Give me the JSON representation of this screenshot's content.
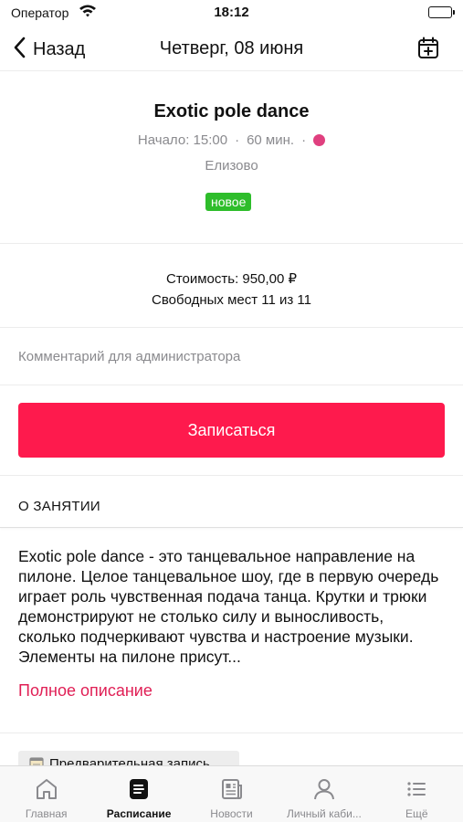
{
  "status_bar": {
    "carrier": "Оператор",
    "time": "18:12"
  },
  "nav": {
    "back_label": "Назад",
    "title": "Четверг, 08 июня",
    "back_icon": "chevron-left-icon",
    "calendar_icon": "calendar-add-icon"
  },
  "class_info": {
    "title": "Exotic pole dance",
    "start": "Начало: 15:00",
    "separator": "·",
    "duration": "60 мин.",
    "color": "#e0407f",
    "location": "Елизово",
    "badge": "новое",
    "badge_color": "#2ebd2b"
  },
  "pricing": {
    "cost": "Стоимость: 950,00 ₽",
    "seats": "Свободных мест 11 из 11"
  },
  "comment": {
    "placeholder": "Комментарий для администратора",
    "value": ""
  },
  "signup": {
    "label": "Записаться",
    "color": "#fe1a4d"
  },
  "about": {
    "title": "О ЗАНЯТИИ",
    "text": "Exotic pole dance - это танцевальное направление на пилоне. Целое танцевальное шоу, где в первую очередь играет роль чувственная подача танца. Крутки и трюки демонстрируют не столько силу и выносливость, сколько подчеркивают чувства и настроение музыки. Элементы на пилоне присут...",
    "full_link": "Полное описание",
    "link_color": "#e01f55"
  },
  "prebook": {
    "label": "Предварительная запись",
    "icon": "notepad-icon"
  },
  "tabs": [
    {
      "label": "Главная",
      "icon": "home-icon",
      "active": false
    },
    {
      "label": "Расписание",
      "icon": "schedule-icon",
      "active": true
    },
    {
      "label": "Новости",
      "icon": "news-icon",
      "active": false
    },
    {
      "label": "Личный каби...",
      "icon": "profile-icon",
      "active": false
    },
    {
      "label": "Ещё",
      "icon": "more-list-icon",
      "active": false
    }
  ]
}
